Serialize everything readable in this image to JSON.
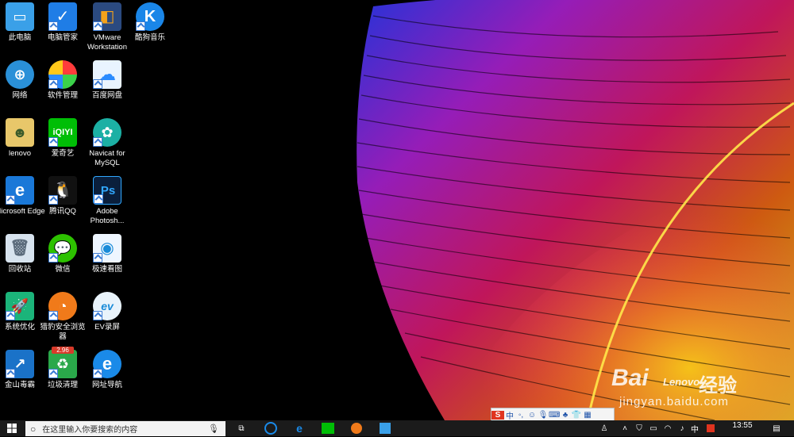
{
  "desktop": {
    "icons": [
      {
        "label": "此电脑",
        "icon": "computer-icon"
      },
      {
        "label": "电脑管家",
        "icon": "shield-icon"
      },
      {
        "label": "VMware Workstation",
        "icon": "vmware-icon"
      },
      {
        "label": "酷狗音乐",
        "icon": "music-k-icon"
      },
      {
        "label": "网络",
        "icon": "network-icon"
      },
      {
        "label": "软件管理",
        "icon": "software-manager-icon"
      },
      {
        "label": "百度网盘",
        "icon": "cloud-drive-icon"
      },
      {
        "label": "lenovo",
        "icon": "user-folder-icon"
      },
      {
        "label": "爱奇艺",
        "icon": "iqiyi-icon"
      },
      {
        "label": "Navicat for MySQL",
        "icon": "navicat-icon"
      },
      {
        "label": "Microsoft Edge",
        "icon": "edge-icon"
      },
      {
        "label": "腾讯QQ",
        "icon": "qq-penguin-icon"
      },
      {
        "label": "Adobe Photosh...",
        "icon": "photoshop-icon"
      },
      {
        "label": "回收站",
        "icon": "recycle-bin-icon"
      },
      {
        "label": "微信",
        "icon": "wechat-icon"
      },
      {
        "label": "极速看图",
        "icon": "image-viewer-icon"
      },
      {
        "label": "系统优化",
        "icon": "system-optimize-icon"
      },
      {
        "label": "猎豹安全浏览器",
        "icon": "cheetah-browser-icon"
      },
      {
        "label": "EV录屏",
        "icon": "ev-recorder-icon"
      },
      {
        "label": "金山毒霸",
        "icon": "antivirus-icon"
      },
      {
        "label": "垃圾清理",
        "icon": "trash-cleaner-icon"
      },
      {
        "label": "网址导航",
        "icon": "ie-navigation-icon"
      }
    ],
    "cleaner_badge": "2.96",
    "wallpaper_text": "Lenovo"
  },
  "taskbar": {
    "search_placeholder": "在这里输入你要搜索的内容",
    "pinned": [
      "task-view-icon",
      "cortana-icon",
      "edge-icon",
      "iqiyi-icon",
      "cheetah-browser-icon",
      "app-icon"
    ],
    "tray": {
      "ime_lang": "中",
      "clock_time": "13:55"
    }
  },
  "ime_toolbar": {
    "label": "S",
    "lang": "中"
  },
  "watermark": {
    "brand": "Bai",
    "brand2": "经验",
    "url": "jingyan.baidu.com"
  },
  "colors": {
    "taskbar": "#1b1b1b",
    "accent": "#0078d7"
  }
}
